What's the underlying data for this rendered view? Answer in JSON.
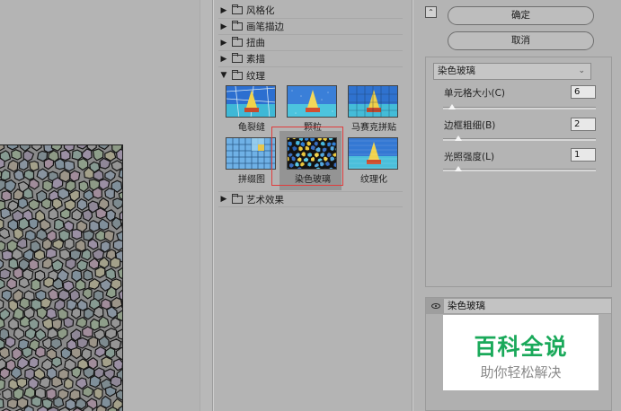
{
  "gallery": {
    "categories_top": [
      {
        "label": "风格化",
        "expanded": false
      },
      {
        "label": "画笔描边",
        "expanded": false
      },
      {
        "label": "扭曲",
        "expanded": false
      },
      {
        "label": "素描",
        "expanded": false
      },
      {
        "label": "纹理",
        "expanded": true
      }
    ],
    "texture_filters": [
      {
        "label": "龟裂缝",
        "selected": false
      },
      {
        "label": "颗粒",
        "selected": false
      },
      {
        "label": "马赛克拼贴",
        "selected": false
      },
      {
        "label": "拼缀图",
        "selected": false
      },
      {
        "label": "染色玻璃",
        "selected": true
      },
      {
        "label": "纹理化",
        "selected": false
      }
    ],
    "categories_bottom": [
      {
        "label": "艺术效果",
        "expanded": false
      }
    ]
  },
  "actions": {
    "ok_label": "确定",
    "cancel_label": "取消"
  },
  "options": {
    "filter_select_value": "染色玻璃",
    "params": [
      {
        "label": "单元格大小(C)",
        "value": "6",
        "level": 0.06
      },
      {
        "label": "边框粗细(B)",
        "value": "2",
        "level": 0.1
      },
      {
        "label": "光照强度(L)",
        "value": "1",
        "level": 0.1
      }
    ]
  },
  "layers": {
    "active_layer_name": "染色玻璃"
  },
  "watermark": {
    "title": "百科全说",
    "subtitle": "助你轻松解决"
  },
  "colors": {
    "selection_outline": "#e03c3c",
    "watermark_green": "#1aa95a"
  }
}
